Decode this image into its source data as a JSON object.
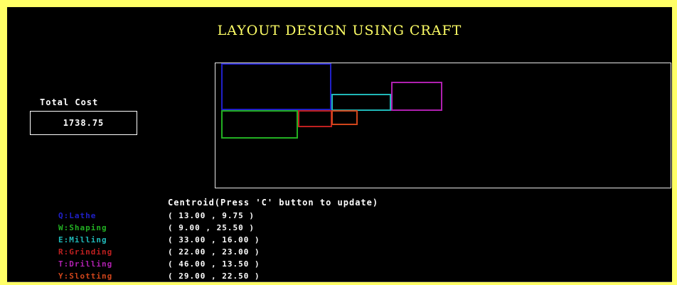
{
  "title": "LAYOUT DESIGN USING CRAFT",
  "total_cost": {
    "label": "Total Cost",
    "value": "1738.75"
  },
  "centroid_header": "Centroid(Press 'C' button to update)",
  "departments": [
    {
      "label": "Q:Lathe",
      "coords": "( 13.00 , 9.75 )",
      "color": "#2020c8"
    },
    {
      "label": "W:Shaping",
      "coords": "( 9.00 , 25.50 )",
      "color": "#22b022"
    },
    {
      "label": "E:Milling",
      "coords": "( 33.00 , 16.00 )",
      "color": "#20b8b8"
    },
    {
      "label": "R:Grinding",
      "coords": "( 22.00 , 23.00 )",
      "color": "#c02020"
    },
    {
      "label": "T:Drilling",
      "coords": "( 46.00 , 13.50 )",
      "color": "#b020b0"
    },
    {
      "label": "Y:Slotting",
      "coords": "( 29.00 , 22.50 )",
      "color": "#d0451b"
    }
  ]
}
